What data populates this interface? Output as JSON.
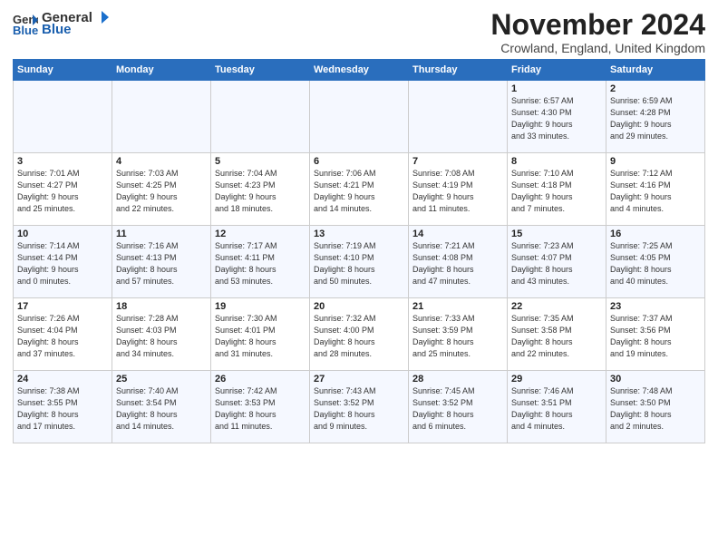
{
  "logo": {
    "general": "General",
    "blue": "Blue"
  },
  "title": "November 2024",
  "location": "Crowland, England, United Kingdom",
  "days_of_week": [
    "Sunday",
    "Monday",
    "Tuesday",
    "Wednesday",
    "Thursday",
    "Friday",
    "Saturday"
  ],
  "weeks": [
    [
      {
        "day": "",
        "info": ""
      },
      {
        "day": "",
        "info": ""
      },
      {
        "day": "",
        "info": ""
      },
      {
        "day": "",
        "info": ""
      },
      {
        "day": "",
        "info": ""
      },
      {
        "day": "1",
        "info": "Sunrise: 6:57 AM\nSunset: 4:30 PM\nDaylight: 9 hours\nand 33 minutes."
      },
      {
        "day": "2",
        "info": "Sunrise: 6:59 AM\nSunset: 4:28 PM\nDaylight: 9 hours\nand 29 minutes."
      }
    ],
    [
      {
        "day": "3",
        "info": "Sunrise: 7:01 AM\nSunset: 4:27 PM\nDaylight: 9 hours\nand 25 minutes."
      },
      {
        "day": "4",
        "info": "Sunrise: 7:03 AM\nSunset: 4:25 PM\nDaylight: 9 hours\nand 22 minutes."
      },
      {
        "day": "5",
        "info": "Sunrise: 7:04 AM\nSunset: 4:23 PM\nDaylight: 9 hours\nand 18 minutes."
      },
      {
        "day": "6",
        "info": "Sunrise: 7:06 AM\nSunset: 4:21 PM\nDaylight: 9 hours\nand 14 minutes."
      },
      {
        "day": "7",
        "info": "Sunrise: 7:08 AM\nSunset: 4:19 PM\nDaylight: 9 hours\nand 11 minutes."
      },
      {
        "day": "8",
        "info": "Sunrise: 7:10 AM\nSunset: 4:18 PM\nDaylight: 9 hours\nand 7 minutes."
      },
      {
        "day": "9",
        "info": "Sunrise: 7:12 AM\nSunset: 4:16 PM\nDaylight: 9 hours\nand 4 minutes."
      }
    ],
    [
      {
        "day": "10",
        "info": "Sunrise: 7:14 AM\nSunset: 4:14 PM\nDaylight: 9 hours\nand 0 minutes."
      },
      {
        "day": "11",
        "info": "Sunrise: 7:16 AM\nSunset: 4:13 PM\nDaylight: 8 hours\nand 57 minutes."
      },
      {
        "day": "12",
        "info": "Sunrise: 7:17 AM\nSunset: 4:11 PM\nDaylight: 8 hours\nand 53 minutes."
      },
      {
        "day": "13",
        "info": "Sunrise: 7:19 AM\nSunset: 4:10 PM\nDaylight: 8 hours\nand 50 minutes."
      },
      {
        "day": "14",
        "info": "Sunrise: 7:21 AM\nSunset: 4:08 PM\nDaylight: 8 hours\nand 47 minutes."
      },
      {
        "day": "15",
        "info": "Sunrise: 7:23 AM\nSunset: 4:07 PM\nDaylight: 8 hours\nand 43 minutes."
      },
      {
        "day": "16",
        "info": "Sunrise: 7:25 AM\nSunset: 4:05 PM\nDaylight: 8 hours\nand 40 minutes."
      }
    ],
    [
      {
        "day": "17",
        "info": "Sunrise: 7:26 AM\nSunset: 4:04 PM\nDaylight: 8 hours\nand 37 minutes."
      },
      {
        "day": "18",
        "info": "Sunrise: 7:28 AM\nSunset: 4:03 PM\nDaylight: 8 hours\nand 34 minutes."
      },
      {
        "day": "19",
        "info": "Sunrise: 7:30 AM\nSunset: 4:01 PM\nDaylight: 8 hours\nand 31 minutes."
      },
      {
        "day": "20",
        "info": "Sunrise: 7:32 AM\nSunset: 4:00 PM\nDaylight: 8 hours\nand 28 minutes."
      },
      {
        "day": "21",
        "info": "Sunrise: 7:33 AM\nSunset: 3:59 PM\nDaylight: 8 hours\nand 25 minutes."
      },
      {
        "day": "22",
        "info": "Sunrise: 7:35 AM\nSunset: 3:58 PM\nDaylight: 8 hours\nand 22 minutes."
      },
      {
        "day": "23",
        "info": "Sunrise: 7:37 AM\nSunset: 3:56 PM\nDaylight: 8 hours\nand 19 minutes."
      }
    ],
    [
      {
        "day": "24",
        "info": "Sunrise: 7:38 AM\nSunset: 3:55 PM\nDaylight: 8 hours\nand 17 minutes."
      },
      {
        "day": "25",
        "info": "Sunrise: 7:40 AM\nSunset: 3:54 PM\nDaylight: 8 hours\nand 14 minutes."
      },
      {
        "day": "26",
        "info": "Sunrise: 7:42 AM\nSunset: 3:53 PM\nDaylight: 8 hours\nand 11 minutes."
      },
      {
        "day": "27",
        "info": "Sunrise: 7:43 AM\nSunset: 3:52 PM\nDaylight: 8 hours\nand 9 minutes."
      },
      {
        "day": "28",
        "info": "Sunrise: 7:45 AM\nSunset: 3:52 PM\nDaylight: 8 hours\nand 6 minutes."
      },
      {
        "day": "29",
        "info": "Sunrise: 7:46 AM\nSunset: 3:51 PM\nDaylight: 8 hours\nand 4 minutes."
      },
      {
        "day": "30",
        "info": "Sunrise: 7:48 AM\nSunset: 3:50 PM\nDaylight: 8 hours\nand 2 minutes."
      }
    ]
  ]
}
